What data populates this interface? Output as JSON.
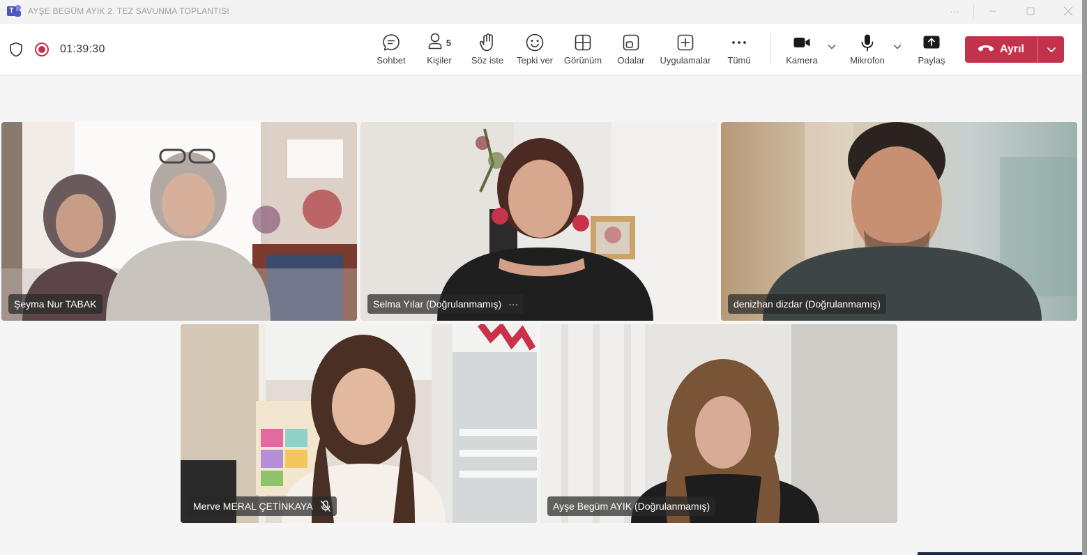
{
  "window": {
    "title": "AYŞE BEGÜM AYIK 2. TEZ SAVUNMA TOPLANTISI",
    "controls": [
      "more-icon",
      "minimize-icon",
      "maximize-icon",
      "close-icon"
    ]
  },
  "toolbar": {
    "timer": "01:39:30",
    "people_count": "5",
    "items": {
      "chat": "Sohbet",
      "people": "Kişiler",
      "raise_hand": "Söz iste",
      "react": "Tepki ver",
      "view": "Görünüm",
      "rooms": "Odalar",
      "apps": "Uygulamalar",
      "more": "Tümü",
      "camera": "Kamera",
      "mic": "Mikrofon",
      "share": "Paylaş"
    },
    "leave_label": "Ayrıl",
    "colors": {
      "leave": "#c4314b",
      "record": "#c4314b"
    }
  },
  "participants": [
    {
      "name": "Şeyma Nur TABAK"
    },
    {
      "name": "Selma Yılar (Doğrulanmamış)",
      "more": "···"
    },
    {
      "name": "denizhan dizdar (Doğrulanmamış)"
    },
    {
      "name": "Merve MERAL ÇETİNKAYA",
      "muted": true
    },
    {
      "name": "Ayşe Begüm AYIK (Doğrulanmamış)"
    }
  ]
}
